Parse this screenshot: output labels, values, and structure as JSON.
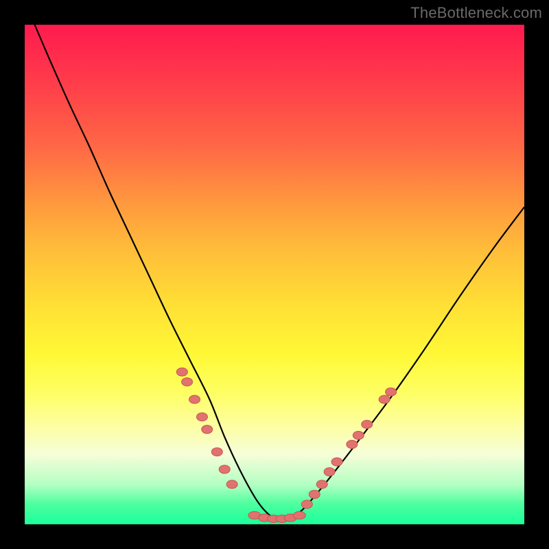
{
  "watermark": "TheBottleneck.com",
  "colors": {
    "frame": "#000000",
    "curve": "#000000",
    "marker_fill": "#e0736f",
    "marker_stroke": "#c6544f"
  },
  "chart_data": {
    "type": "line",
    "title": "",
    "xlabel": "",
    "ylabel": "",
    "xlim": [
      0,
      100
    ],
    "ylim": [
      0,
      100
    ],
    "grid": false,
    "annotations": [
      "TheBottleneck.com"
    ],
    "series": [
      {
        "name": "curve",
        "x": [
          2,
          5,
          9,
          13,
          17,
          21,
          25,
          29,
          33,
          37,
          40,
          43,
          46,
          48,
          50,
          52,
          55,
          58,
          62,
          67,
          73,
          80,
          87,
          94,
          100
        ],
        "y": [
          100,
          93,
          84,
          75.5,
          66.5,
          58,
          49.5,
          41,
          33,
          25,
          17.5,
          11,
          5.5,
          2.8,
          1.2,
          1.2,
          2.4,
          5.6,
          10.5,
          17,
          25,
          35,
          45.5,
          55.5,
          63.5
        ]
      }
    ],
    "markers": {
      "left_cluster": [
        {
          "x": 31.5,
          "y": 30.5
        },
        {
          "x": 32.5,
          "y": 28.5
        },
        {
          "x": 34.0,
          "y": 25.0
        },
        {
          "x": 35.5,
          "y": 21.5
        },
        {
          "x": 36.5,
          "y": 19.0
        },
        {
          "x": 38.5,
          "y": 14.5
        },
        {
          "x": 40.0,
          "y": 11.0
        },
        {
          "x": 41.5,
          "y": 8.0
        }
      ],
      "right_cluster": [
        {
          "x": 56.5,
          "y": 4.0
        },
        {
          "x": 58.0,
          "y": 6.0
        },
        {
          "x": 59.5,
          "y": 8.0
        },
        {
          "x": 61.0,
          "y": 10.5
        },
        {
          "x": 62.5,
          "y": 12.5
        },
        {
          "x": 65.5,
          "y": 16.0
        },
        {
          "x": 66.8,
          "y": 17.8
        },
        {
          "x": 68.5,
          "y": 20.0
        },
        {
          "x": 72.0,
          "y": 25.0
        },
        {
          "x": 73.3,
          "y": 26.5
        }
      ],
      "bottom_cluster": [
        {
          "x": 46.0,
          "y": 1.8
        },
        {
          "x": 48.0,
          "y": 1.3
        },
        {
          "x": 49.8,
          "y": 1.1
        },
        {
          "x": 51.5,
          "y": 1.1
        },
        {
          "x": 53.2,
          "y": 1.3
        },
        {
          "x": 55.0,
          "y": 1.8
        }
      ]
    }
  }
}
